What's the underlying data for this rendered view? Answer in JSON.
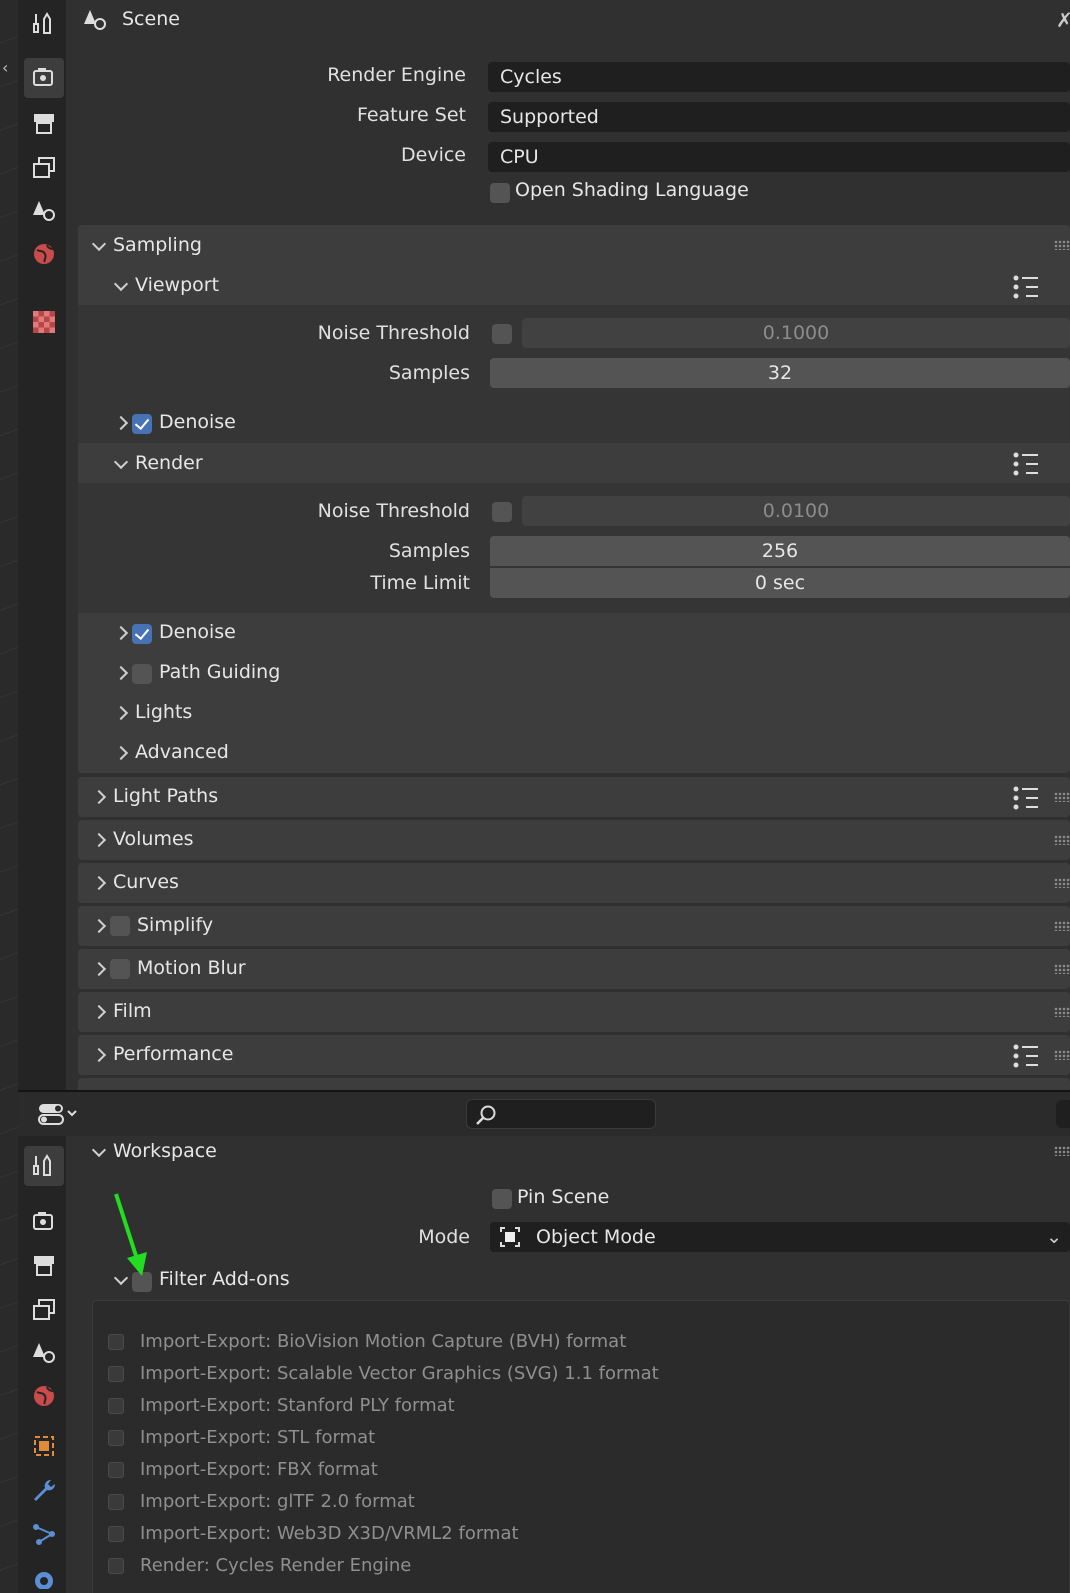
{
  "header": {
    "title": "Scene"
  },
  "render_settings": {
    "render_engine": {
      "label": "Render Engine",
      "value": "Cycles"
    },
    "feature_set": {
      "label": "Feature Set",
      "value": "Supported"
    },
    "device": {
      "label": "Device",
      "value": "CPU"
    },
    "osl": {
      "label": "Open Shading Language",
      "checked": false
    }
  },
  "sampling": {
    "title": "Sampling",
    "viewport": {
      "title": "Viewport",
      "noise_threshold": {
        "label": "Noise Threshold",
        "value": "0.1000"
      },
      "samples": {
        "label": "Samples",
        "value": "32"
      },
      "denoise": {
        "label": "Denoise",
        "checked": true
      }
    },
    "render": {
      "title": "Render",
      "noise_threshold": {
        "label": "Noise Threshold",
        "value": "0.0100"
      },
      "samples": {
        "label": "Samples",
        "value": "256"
      },
      "time_limit": {
        "label": "Time Limit",
        "value": "0 sec"
      },
      "denoise": {
        "label": "Denoise",
        "checked": true
      },
      "path_guiding": {
        "label": "Path Guiding",
        "checked": false
      },
      "lights": "Lights",
      "advanced": "Advanced"
    }
  },
  "panels": [
    {
      "label": "Light Paths"
    },
    {
      "label": "Volumes"
    },
    {
      "label": "Curves"
    },
    {
      "label": "Simplify"
    },
    {
      "label": "Motion Blur"
    },
    {
      "label": "Film"
    },
    {
      "label": "Performance"
    }
  ],
  "workspace": {
    "title": "Workspace",
    "pin_scene": {
      "label": "Pin Scene",
      "checked": false
    },
    "mode": {
      "label": "Mode",
      "value": "Object Mode"
    },
    "filter_addons": {
      "label": "Filter Add-ons",
      "checked": false
    },
    "addons": [
      "Import-Export: BioVision Motion Capture (BVH) format",
      "Import-Export: Scalable Vector Graphics (SVG) 1.1 format",
      "Import-Export: Stanford PLY format",
      "Import-Export: STL format",
      "Import-Export: FBX format",
      "Import-Export: glTF 2.0 format",
      "Import-Export: Web3D X3D/VRML2 format",
      "Render: Cycles Render Engine"
    ]
  },
  "colors": {
    "accent": "#4772b3",
    "annotation_arrow": "#22dd22",
    "panel": "#3d3d3d",
    "background": "#303030"
  }
}
